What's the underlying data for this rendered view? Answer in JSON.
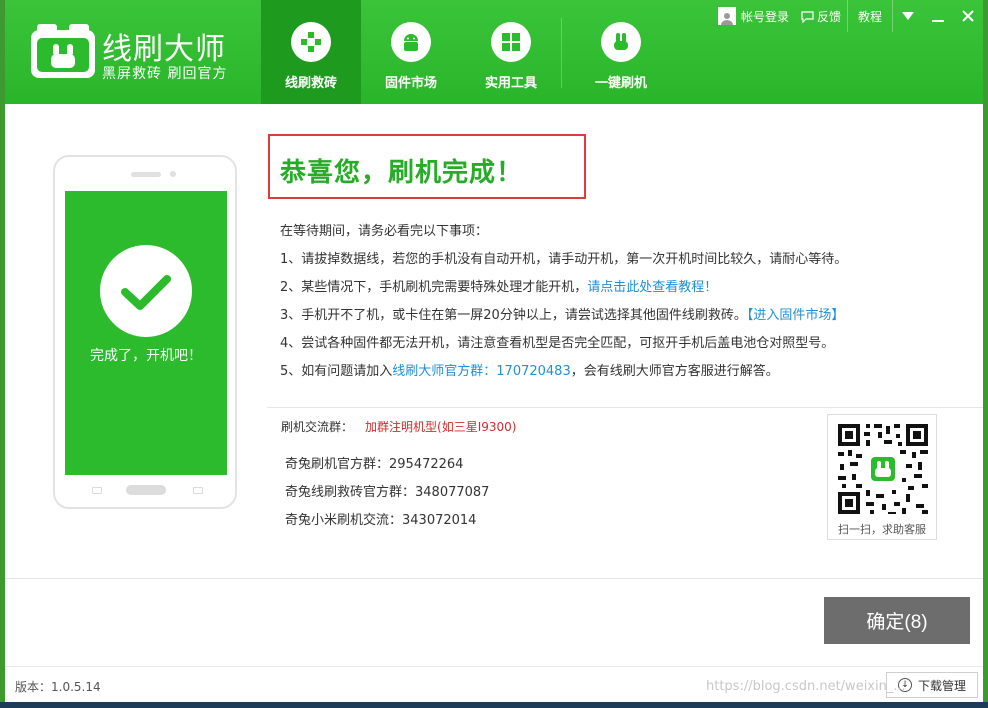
{
  "app": {
    "title": "线刷大师",
    "subtitle": "黑屏救砖 刷回官方"
  },
  "nav": [
    {
      "label": "线刷救砖",
      "icon": "plus-cross-icon",
      "active": true
    },
    {
      "label": "固件市场",
      "icon": "android-icon",
      "active": false
    },
    {
      "label": "实用工具",
      "icon": "grid-icon",
      "active": false
    },
    {
      "label": "一键刷机",
      "icon": "rabbit-icon",
      "active": false
    }
  ],
  "topbar": {
    "login": "帐号登录",
    "feedback": "反馈",
    "tutorial": "教程"
  },
  "phone": {
    "done_text": "完成了，开机吧！"
  },
  "main": {
    "congrats": "恭喜您，刷机完成！",
    "intro": "在等待期间，请务必看完以下事项：",
    "note1": "1、请拔掉数据线，若您的手机没有自动开机，请手动开机，第一次开机时间比较久，请耐心等待。",
    "note2_text": "2、某些情况下，手机刷机完需要特殊处理才能开机，",
    "note2_link": "请点击此处查看教程！",
    "note3_text": "3、手机开不了机，或卡住在第一屏20分钟以上，请尝试选择其他固件线刷救砖。",
    "note3_link": "【进入固件市场】",
    "note4": "4、尝试各种固件都无法开机，请注意查看机型是否完全匹配，可抠开手机后盖电池仓对照型号。",
    "note5_text": "5、如有问题请加入",
    "note5_link": "线刷大师官方群：170720483",
    "note5_tail": "，会有线刷大师官方客服进行解答。"
  },
  "groups": {
    "label": "刷机交流群：",
    "hint": "加群注明机型(如三星I9300)",
    "items": [
      "奇兔刷机官方群：295472264",
      "奇兔线刷救砖官方群：348077087",
      "奇兔小米刷机交流：343072014"
    ]
  },
  "qr": {
    "caption": "扫一扫，求助客服"
  },
  "confirm": {
    "label": "确定(8)"
  },
  "footer": {
    "version": "版本：1.0.5.14",
    "download": "下载管理",
    "watermark": "https://blog.csdn.net/weixin_..."
  },
  "colors": {
    "brand_green": "#2cbb2c",
    "link_blue": "#1f8fd8",
    "alert_red": "#e03b3b",
    "button_gray": "#6d6d6d"
  }
}
